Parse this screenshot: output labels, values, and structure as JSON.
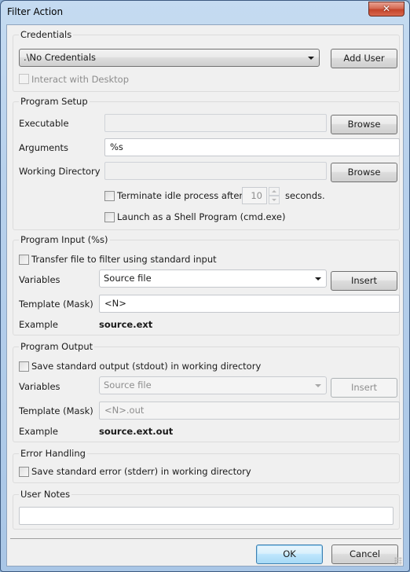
{
  "window": {
    "title": "Filter Action",
    "close_glyph": "✕"
  },
  "credentials": {
    "group_title": "Credentials",
    "account_select_value": ".\\No Credentials",
    "add_user_label": "Add User",
    "interact_desktop_label": "Interact with Desktop",
    "interact_desktop_checked": false,
    "interact_desktop_enabled": false
  },
  "program_setup": {
    "group_title": "Program Setup",
    "executable_label": "Executable",
    "executable_value": "",
    "browse_label": "Browse",
    "arguments_label": "Arguments",
    "arguments_value": "%s",
    "working_dir_label": "Working Directory",
    "working_dir_value": "",
    "terminate_label": "Terminate idle process after",
    "terminate_checked": false,
    "timeout_value": "10",
    "seconds_label": "seconds.",
    "shell_label": "Launch as a Shell Program (cmd.exe)",
    "shell_checked": false
  },
  "program_input": {
    "group_title": "Program Input (%s)",
    "transfer_label": "Transfer file to filter using standard input",
    "transfer_checked": false,
    "variables_label": "Variables",
    "variables_value": "Source file",
    "insert_label": "Insert",
    "template_label": "Template (Mask)",
    "template_value": "<N>",
    "example_label": "Example",
    "example_value": "source.ext"
  },
  "program_output": {
    "group_title": "Program Output",
    "save_stdout_label": "Save standard output (stdout) in working directory",
    "save_stdout_checked": false,
    "variables_label": "Variables",
    "variables_value": "Source file",
    "insert_label": "Insert",
    "template_label": "Template (Mask)",
    "template_value": "<N>.out",
    "example_label": "Example",
    "example_value": "source.ext.out"
  },
  "error_handling": {
    "group_title": "Error Handling",
    "save_stderr_label": "Save standard error (stderr) in working directory",
    "save_stderr_checked": false
  },
  "user_notes": {
    "group_title": "User Notes",
    "notes_value": ""
  },
  "footer": {
    "ok_label": "OK",
    "cancel_label": "Cancel"
  }
}
